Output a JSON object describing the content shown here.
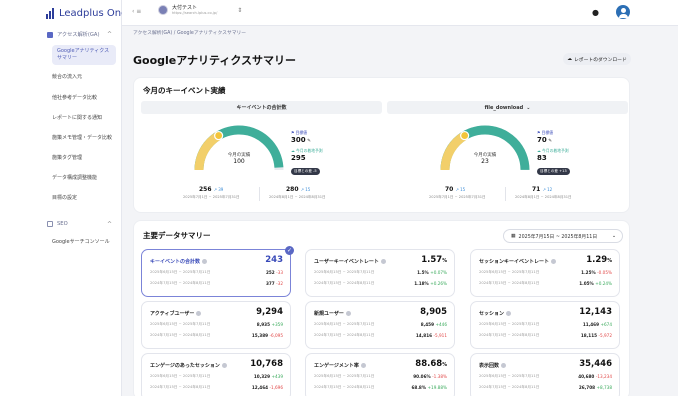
{
  "brand": "Leadplus One",
  "sidebar": {
    "section1": "アクセス解析(GA)",
    "items": [
      "Googleアナリティクスサマリー",
      "競合の流入元",
      "他社参考データ比較",
      "レポートに関する通知",
      "施策メモ管理・データ比較",
      "施策タグ管理",
      "データ構成調整機能",
      "目標の設定"
    ],
    "section2": "SEO",
    "seo_items": [
      "Googleサーチコンソール"
    ]
  },
  "topbar": {
    "site_name": "大付テスト",
    "site_url": "https://search.lplus.co.jp/"
  },
  "breadcrumb": "アクセス解析(GA)  /  Googleアナリティクスサマリー",
  "page_title": "Googleアナリティクスサマリー",
  "download_label": "レポートのダウンロード",
  "kpi": {
    "title": "今月のキーイベント実績",
    "panels": [
      {
        "header": "キーイベントの合計数",
        "dropdown": false,
        "current_label": "今月の実績",
        "current": "100",
        "target_label": "目標値",
        "target": "300",
        "forecast_label": "今月の着地予測",
        "forecast": "295",
        "pill": "目標との差 -5",
        "progress": 0.33,
        "forecast_progress": 0.98,
        "s1": "256",
        "s1inc": "↗ 39",
        "s1sub": "2025年7月1日 ~ 2025年7月31日",
        "s2": "280",
        "s2inc": "↗ 15",
        "s2sub": "2024年8月1日 ~ 2024年8月31日"
      },
      {
        "header": "file_download",
        "dropdown": true,
        "current_label": "今月の実績",
        "current": "23",
        "target_label": "目標値",
        "target": "70",
        "forecast_label": "今月の着地予測",
        "forecast": "83",
        "pill": "目標との差 +13",
        "progress": 0.33,
        "forecast_progress": 1,
        "s1": "70",
        "s1inc": "↗ 15",
        "s1sub": "2025年7月1日 ~ 2025年7月31日",
        "s2": "71",
        "s2inc": "↗ 12",
        "s2sub": "2024年8月1日 ~ 2024年8月31日"
      }
    ]
  },
  "summary": {
    "title": "主要データサマリー",
    "date_range": "2025年7月15日  ~  2025年8月11日",
    "metrics": [
      {
        "name": "キーイベントの合計数",
        "value": "243",
        "unit": "",
        "r1": "2025年6月15日 ~ 2025年7月11日",
        "v1": "252",
        "d1": "-33",
        "d1up": false,
        "r2": "2024年7月15日 ~ 2024年8月11日",
        "v2": "377",
        "d2": "-32",
        "d2up": false
      },
      {
        "name": "ユーザーキーイベントレート",
        "value": "1.57",
        "unit": "%",
        "r1": "2025年6月15日 ~ 2025年7月11日",
        "v1": "1.5%",
        "d1": "+0.07%",
        "d1up": true,
        "r2": "2024年7月15日 ~ 2024年8月11日",
        "v2": "1.18%",
        "d2": "+0.26%",
        "d2up": true
      },
      {
        "name": "セッションキーイベントレート",
        "value": "1.29",
        "unit": "%",
        "r1": "2025年6月15日 ~ 2025年7月11日",
        "v1": "1.25%",
        "d1": "-0.05%",
        "d1up": false,
        "r2": "2024年7月15日 ~ 2024年8月11日",
        "v2": "1.05%",
        "d2": "+0.24%",
        "d2up": true
      },
      {
        "name": "アクティブユーザー",
        "value": "9,294",
        "unit": "",
        "r1": "2025年6月15日 ~ 2025年7月11日",
        "v1": "8,935",
        "d1": "+359",
        "d1up": true,
        "r2": "2024年7月15日 ~ 2024年8月11日",
        "v2": "15,389",
        "d2": "-6,095",
        "d2up": false
      },
      {
        "name": "新規ユーザー",
        "value": "8,905",
        "unit": "",
        "r1": "2025年6月15日 ~ 2025年7月11日",
        "v1": "8,459",
        "d1": "+446",
        "d1up": true,
        "r2": "2024年7月15日 ~ 2024年8月11日",
        "v2": "14,816",
        "d2": "-5,911",
        "d2up": false
      },
      {
        "name": "セッション",
        "value": "12,143",
        "unit": "",
        "r1": "2025年6月15日 ~ 2025年7月11日",
        "v1": "11,469",
        "d1": "+674",
        "d1up": true,
        "r2": "2024年7月15日 ~ 2024年8月11日",
        "v2": "18,115",
        "d2": "-5,972",
        "d2up": false
      },
      {
        "name": "エンゲージのあったセッション",
        "value": "10,768",
        "unit": "",
        "r1": "2025年6月15日 ~ 2025年7月11日",
        "v1": "10,329",
        "d1": "+439",
        "d1up": true,
        "r2": "2024年7月15日 ~ 2024年8月11日",
        "v2": "12,464",
        "d2": "-1,696",
        "d2up": false
      },
      {
        "name": "エンゲージメント率",
        "value": "88.68",
        "unit": "%",
        "r1": "2025年6月15日 ~ 2025年7月11日",
        "v1": "90.06%",
        "d1": "-1.38%",
        "d1up": false,
        "r2": "2024年7月15日 ~ 2024年8月11日",
        "v2": "68.8%",
        "d2": "+19.88%",
        "d2up": true
      },
      {
        "name": "表示回数",
        "value": "35,446",
        "unit": "",
        "r1": "2025年6月15日 ~ 2025年7月11日",
        "v1": "40,680",
        "d1": "-13,234",
        "d1up": false,
        "r2": "2024年7月15日 ~ 2024年8月11日",
        "v2": "26,708",
        "d2": "+8,738",
        "d2up": true
      }
    ]
  },
  "colors": {
    "accent": "#3849b8",
    "gauge_track": "#e8e9ee",
    "gauge_fill": "#f2cf6a",
    "gauge_forecast": "#3fae9a",
    "up": "#3aaa5c",
    "down": "#e14747"
  }
}
